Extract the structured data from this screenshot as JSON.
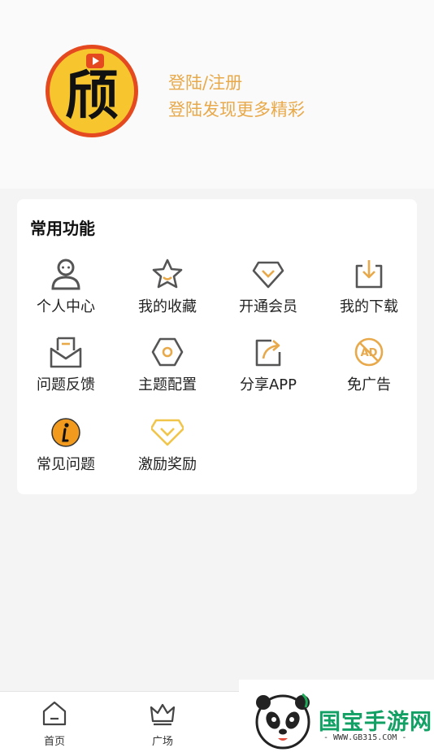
{
  "profile": {
    "avatar_char": "颀",
    "login_label": "登陆/注册",
    "subtitle": "登陆发现更多精彩"
  },
  "functions": {
    "title": "常用功能",
    "items": [
      {
        "label": "个人中心",
        "icon": "user-icon"
      },
      {
        "label": "我的收藏",
        "icon": "star-icon"
      },
      {
        "label": "开通会员",
        "icon": "diamond-icon"
      },
      {
        "label": "我的下载",
        "icon": "download-icon"
      },
      {
        "label": "问题反馈",
        "icon": "feedback-mail-icon"
      },
      {
        "label": "主题配置",
        "icon": "hexagon-theme-icon"
      },
      {
        "label": "分享APP",
        "icon": "share-icon"
      },
      {
        "label": "免广告",
        "icon": "no-ad-icon"
      },
      {
        "label": "常见问题",
        "icon": "info-icon"
      },
      {
        "label": "激励奖励",
        "icon": "reward-gem-icon"
      }
    ]
  },
  "tabbar": {
    "items": [
      {
        "label": "首页",
        "icon": "home-icon"
      },
      {
        "label": "广场",
        "icon": "crown-icon"
      }
    ]
  },
  "watermark": {
    "brand": "国宝手游网",
    "url": "- WWW.GB315.COM -"
  },
  "colors": {
    "accent": "#e8a94a",
    "icon_gray": "#555555",
    "brand_green": "#12a064"
  }
}
